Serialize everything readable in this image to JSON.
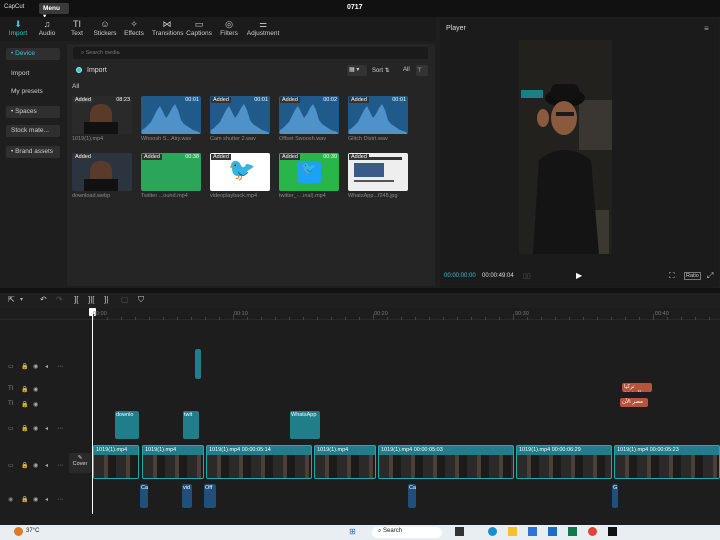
{
  "app": {
    "logo": "CapCut",
    "menu": "Menu",
    "menu_caret": "▾",
    "project_name": "0717"
  },
  "toolbar": {
    "items": [
      {
        "label": "Import",
        "icon": "import-icon",
        "glyph": "⬇"
      },
      {
        "label": "Audio",
        "icon": "audio-icon",
        "glyph": "♫"
      },
      {
        "label": "Text",
        "icon": "text-icon",
        "glyph": "TI"
      },
      {
        "label": "Stickers",
        "icon": "stickers-icon",
        "glyph": "☺"
      },
      {
        "label": "Effects",
        "icon": "effects-icon",
        "glyph": "✧"
      },
      {
        "label": "Transitions",
        "icon": "transitions-icon",
        "glyph": "⋈"
      },
      {
        "label": "Captions",
        "icon": "captions-icon",
        "glyph": "▭"
      },
      {
        "label": "Filters",
        "icon": "filters-icon",
        "glyph": "◎"
      },
      {
        "label": "Adjustment",
        "icon": "adjustment-icon",
        "glyph": "⚌"
      }
    ]
  },
  "leftnav": {
    "device": "• Device",
    "import": "Import",
    "presets": "My presets",
    "spaces": "• Spaces",
    "stock": "Stock mate...",
    "brand": "• Brand assets"
  },
  "media": {
    "search_placeholder": "Search media",
    "import_label": "Import",
    "sort_label": "Sort",
    "all_filter": "All",
    "section_all": "All",
    "items": [
      {
        "name": "1019(1).mp4",
        "badge": "Added",
        "duration": "08:23",
        "kind": "video-person",
        "color": "#2a2a2a"
      },
      {
        "name": "Whoosh S...Airy.wav",
        "badge": "",
        "duration": "00:01",
        "kind": "wave",
        "color": "#1f5a8a"
      },
      {
        "name": "Cam shutter 2.wav",
        "badge": "Added",
        "duration": "00:01",
        "kind": "wave",
        "color": "#1f5a8a"
      },
      {
        "name": "Offset Swoosh.wav",
        "badge": "Added",
        "duration": "00:02",
        "kind": "wave",
        "color": "#1f5a8a"
      },
      {
        "name": "Glitch Distrt.wav",
        "badge": "Added",
        "duration": "00:01",
        "kind": "wave",
        "color": "#1f5a8a"
      },
      {
        "name": "download.webp",
        "badge": "Added",
        "duration": "",
        "kind": "image-person",
        "color": "#2c3440"
      },
      {
        "name": "Twitter ...ound.mp4",
        "badge": "Added",
        "duration": "00:38",
        "kind": "green",
        "color": "#2aa55a"
      },
      {
        "name": "videoplayback.mp4",
        "badge": "Added",
        "duration": "",
        "kind": "twitter-white",
        "color": "#ffffff"
      },
      {
        "name": "twitter_-...inal).mp4",
        "badge": "Added",
        "duration": "00:30",
        "kind": "twitter-green",
        "color": "#28b54a"
      },
      {
        "name": "WhatsApp...f248.jpg",
        "badge": "Added",
        "duration": "",
        "kind": "doc",
        "color": "#eeeeee"
      }
    ]
  },
  "player": {
    "title": "Player",
    "menu_icon": "≡",
    "current_time": "00:00:00:00",
    "total_time": "00:00:49:04",
    "play_icon": "▶",
    "ratio_label": "Ratio"
  },
  "timeline": {
    "ticks": [
      "00:00",
      "00:10",
      "00:20",
      "00:30",
      "00:40"
    ],
    "cover_label": "Cover",
    "text_clips": [
      "تركيا الجديدة",
      "مصر الآن"
    ],
    "overlay_clips": [
      "downlo",
      "twit",
      "WhatsApp"
    ],
    "main_clips": [
      {
        "label": "1019(1).mp4"
      },
      {
        "label": "1019(1).mp4"
      },
      {
        "label": "1019(1).mp4  00:00:05:14"
      },
      {
        "label": "1019(1).mp4"
      },
      {
        "label": "1019(1).mp4  00:00:05:03"
      },
      {
        "label": "1019(1).mp4  00:00:06:29"
      },
      {
        "label": "1019(1).mp4  00:00:05:23"
      }
    ],
    "audio_clips": [
      "Ca",
      "vid",
      "Off",
      "Ca",
      "G"
    ]
  },
  "taskbar": {
    "temperature": "37°C",
    "search": "Search"
  },
  "colors": {
    "accent": "#36c6d6",
    "clip_teal": "#1f7e8a",
    "audio_blue": "#1f4f7a",
    "text_clip": "#b5533c"
  }
}
